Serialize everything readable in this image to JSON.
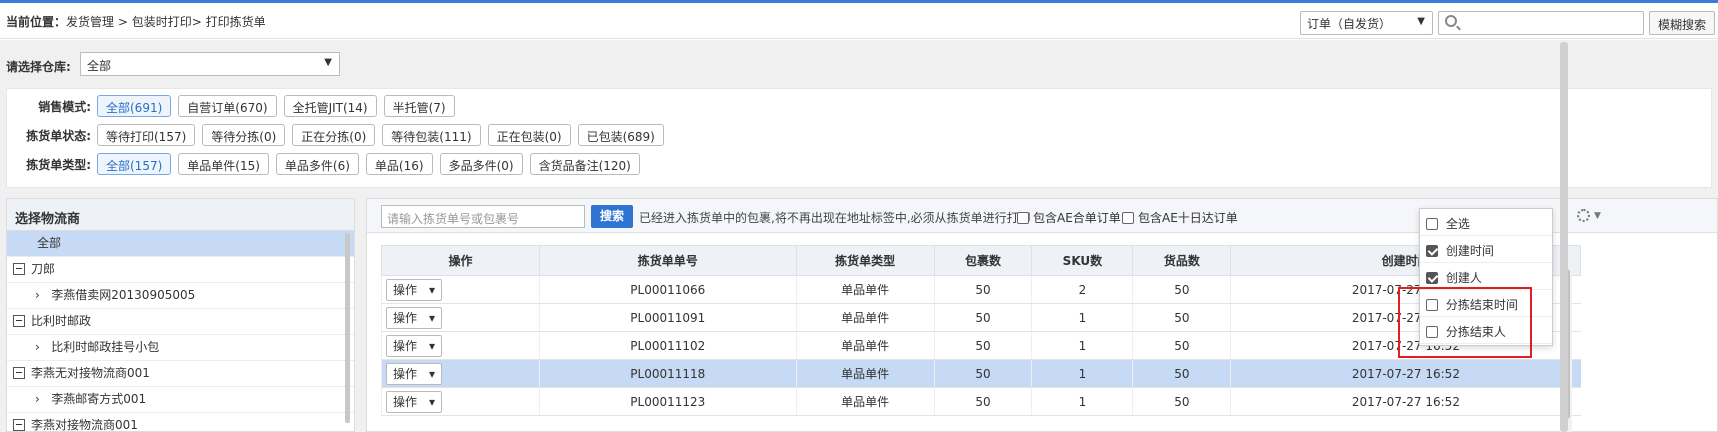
{
  "header": {
    "crumb_label": "当前位置：",
    "crumb_path": "发货管理 > 包装时打印> 打印拣货单",
    "order_select": "订单（自发货）",
    "fuzzy_search": "模糊搜索"
  },
  "warehouse": {
    "label": "请选择仓库:",
    "value": "全部"
  },
  "filters": [
    {
      "label": "销售模式:",
      "chips": [
        "全部(691)",
        "自营订单(670)",
        "全托管JIT(14)",
        "半托管(7)"
      ],
      "active": 0
    },
    {
      "label": "拣货单状态:",
      "chips": [
        "等待打印(157)",
        "等待分拣(0)",
        "正在分拣(0)",
        "等待包装(111)",
        "正在包装(0)",
        "已包装(689)"
      ],
      "active": -1
    },
    {
      "label": "拣货单类型:",
      "chips": [
        "全部(157)",
        "单品单件(15)",
        "单品多件(6)",
        "单品(16)",
        "多品多件(0)",
        "含货品备注(120)"
      ],
      "active": 0
    }
  ],
  "logistics": {
    "title": "选择物流商",
    "items": [
      {
        "label": "全部",
        "kind": "all"
      },
      {
        "label": "刀郎",
        "kind": "group"
      },
      {
        "label": "李燕借卖网20130905005",
        "kind": "child"
      },
      {
        "label": "比利时邮政",
        "kind": "group"
      },
      {
        "label": "比利时邮政挂号小包",
        "kind": "child"
      },
      {
        "label": "李燕无对接物流商001",
        "kind": "group"
      },
      {
        "label": "李燕邮寄方式001",
        "kind": "child"
      },
      {
        "label": "李燕对接物流商001",
        "kind": "group"
      }
    ]
  },
  "toolbar": {
    "search_placeholder": "请输入拣货单号或包裹号",
    "search_button": "搜索",
    "note": "已经进入拣货单中的包裹,将不再出现在地址标签中,必须从拣货单进行打印",
    "cb_ae_merge": "包含AE合单订单",
    "cb_ae_ten": "包含AE十日达订单"
  },
  "table": {
    "headers": [
      "操作",
      "拣货单单号",
      "拣货单类型",
      "包裹数",
      "SKU数",
      "货品数",
      "创建时间"
    ],
    "op_label": "操作",
    "rows": [
      [
        "PL00011066",
        "单品单件",
        "50",
        "2",
        "50",
        "2017-07-27 16:52"
      ],
      [
        "PL00011091",
        "单品单件",
        "50",
        "1",
        "50",
        "2017-07-27 16:52"
      ],
      [
        "PL00011102",
        "单品单件",
        "50",
        "1",
        "50",
        "2017-07-27 16:52"
      ],
      [
        "PL00011118",
        "单品单件",
        "50",
        "1",
        "50",
        "2017-07-27 16:52"
      ],
      [
        "PL00011123",
        "单品单件",
        "50",
        "1",
        "50",
        "2017-07-27 16:52"
      ]
    ],
    "highlight_row": 3
  },
  "column_menu": {
    "items": [
      {
        "label": "全选",
        "checked": false
      },
      {
        "label": "创建时间",
        "checked": true
      },
      {
        "label": "创建人",
        "checked": true
      },
      {
        "label": "分拣结束时间",
        "checked": false
      },
      {
        "label": "分拣结束人",
        "checked": false
      }
    ]
  }
}
